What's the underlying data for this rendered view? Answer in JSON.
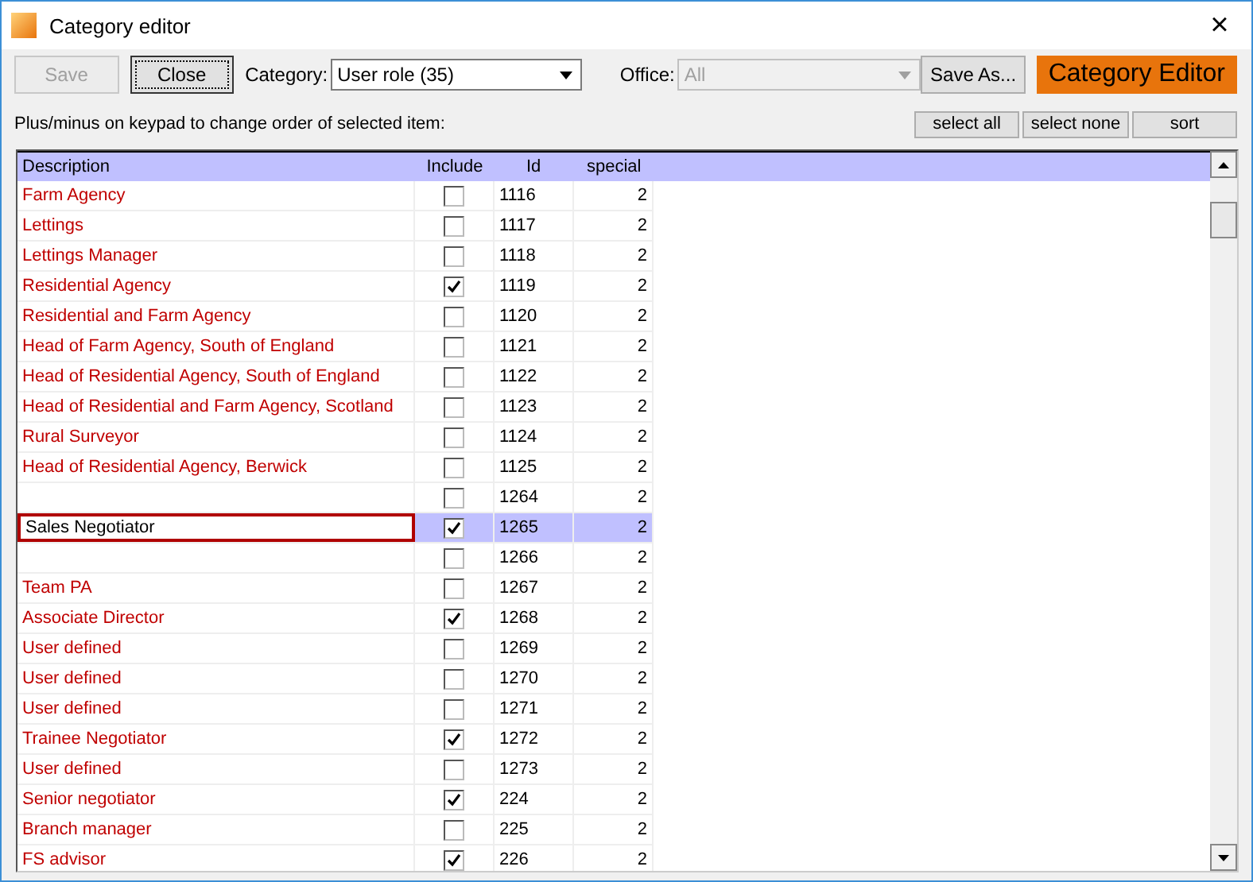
{
  "window": {
    "title": "Category editor",
    "close": "×"
  },
  "toolbar": {
    "buttons": [
      {
        "label": "Save",
        "disabled": true,
        "focused": false
      },
      {
        "label": "Close",
        "disabled": false,
        "focused": true
      }
    ],
    "category": {
      "label": "Category:",
      "value": "User role (35)",
      "disabled": false
    },
    "office": {
      "label": "Office:",
      "value": "All",
      "disabled": true
    },
    "save_as": "Save As...",
    "banner": "Category Editor"
  },
  "hint": "Plus/minus on keypad to change order of selected item:",
  "list_buttons": [
    "select all",
    "select none",
    "sort"
  ],
  "table": {
    "columns": [
      "Description",
      "Include",
      "Id",
      "special"
    ],
    "rows": [
      {
        "description": "Farm Agency",
        "include": false,
        "id": "1116",
        "special": "2",
        "selected": false
      },
      {
        "description": "Lettings",
        "include": false,
        "id": "1117",
        "special": "2",
        "selected": false
      },
      {
        "description": "Lettings Manager",
        "include": false,
        "id": "1118",
        "special": "2",
        "selected": false
      },
      {
        "description": "Residential Agency",
        "include": true,
        "id": "1119",
        "special": "2",
        "selected": false
      },
      {
        "description": "Residential and Farm Agency",
        "include": false,
        "id": "1120",
        "special": "2",
        "selected": false
      },
      {
        "description": "Head of Farm Agency, South of England",
        "include": false,
        "id": "1121",
        "special": "2",
        "selected": false
      },
      {
        "description": "Head of Residential Agency, South of England",
        "include": false,
        "id": "1122",
        "special": "2",
        "selected": false
      },
      {
        "description": "Head of Residential and Farm Agency, Scotland",
        "include": false,
        "id": "1123",
        "special": "2",
        "selected": false
      },
      {
        "description": "Rural Surveyor",
        "include": false,
        "id": "1124",
        "special": "2",
        "selected": false
      },
      {
        "description": "Head of Residential Agency, Berwick",
        "include": false,
        "id": "1125",
        "special": "2",
        "selected": false
      },
      {
        "include": false,
        "id": "1264",
        "special": "2",
        "selected": false
      },
      {
        "description": "Sales Negotiator",
        "include": true,
        "id": "1265",
        "special": "2",
        "selected": true
      },
      {
        "include": false,
        "id": "1266",
        "special": "2",
        "selected": false
      },
      {
        "description": "Team PA",
        "include": false,
        "id": "1267",
        "special": "2",
        "selected": false
      },
      {
        "description": "Associate Director",
        "include": true,
        "id": "1268",
        "special": "2",
        "selected": false
      },
      {
        "description": "User defined",
        "include": false,
        "id": "1269",
        "special": "2",
        "selected": false
      },
      {
        "description": "User defined",
        "include": false,
        "id": "1270",
        "special": "2",
        "selected": false
      },
      {
        "description": "User defined",
        "include": false,
        "id": "1271",
        "special": "2",
        "selected": false
      },
      {
        "description": "Trainee Negotiator",
        "include": true,
        "id": "1272",
        "special": "2",
        "selected": false
      },
      {
        "description": "User defined",
        "include": false,
        "id": "1273",
        "special": "2",
        "selected": false
      },
      {
        "description": "Senior negotiator",
        "include": true,
        "id": "224",
        "special": "2",
        "selected": false
      },
      {
        "description": "Branch manager",
        "include": false,
        "id": "225",
        "special": "2",
        "selected": false
      },
      {
        "description": "FS advisor",
        "include": true,
        "id": "226",
        "special": "2",
        "selected": false
      }
    ]
  }
}
